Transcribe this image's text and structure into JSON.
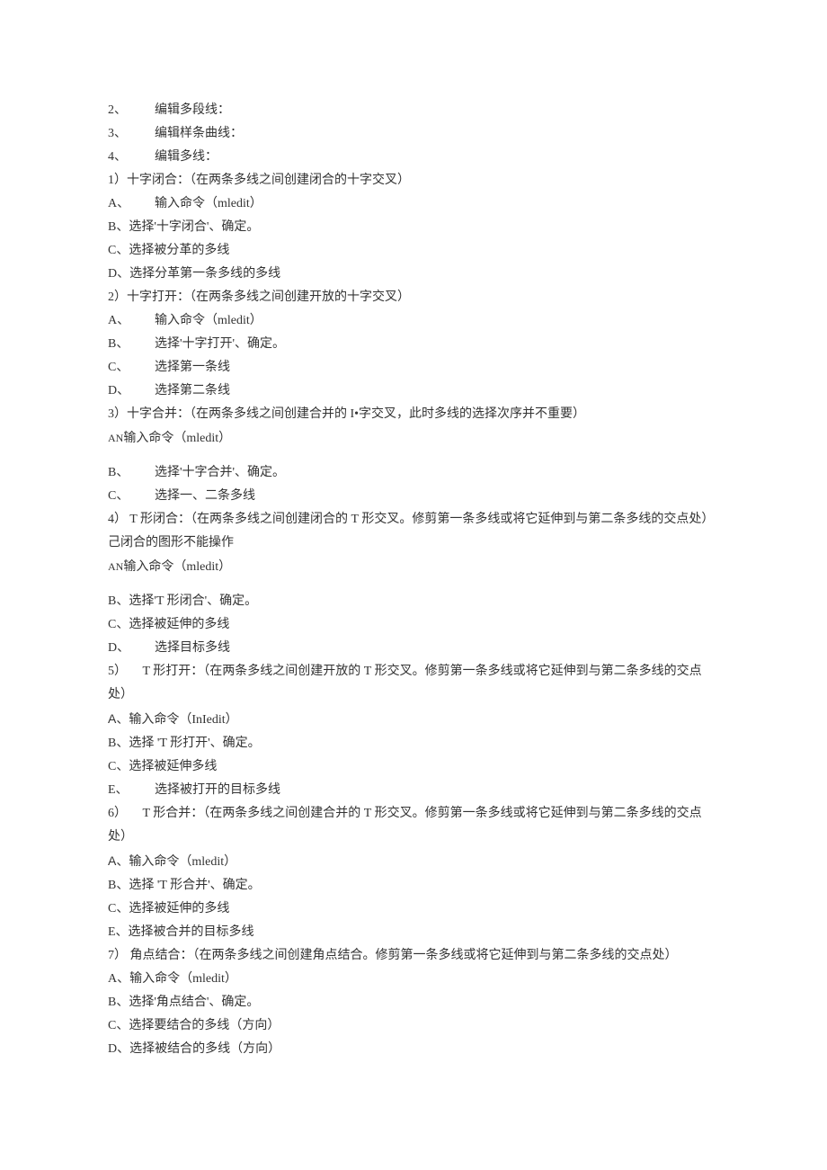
{
  "lines": {
    "l01a": "2、",
    "l01b": "编辑多段线：",
    "l02a": "3、",
    "l02b": "编辑样条曲线：",
    "l03a": "4、",
    "l03b": "编辑多线：",
    "l04": "1）十字闭合：（在两条多线之间创建闭合的十字交叉）",
    "l05a": "A、",
    "l05b": "输入命令（mledit）",
    "l06": "B、选择'十字闭合'、确定。",
    "l07": "C、选择被分革的多线",
    "l08": "D、选择分革第一条多线的多线",
    "l09": "2）十字打开：（在两条多线之间创建开放的十字交叉）",
    "l10a": "A、",
    "l10b": "输入命令（mledit）",
    "l11a": "B、",
    "l11b": "选择'十字打开'、确定。",
    "l12a": "C、",
    "l12b": "选择第一条线",
    "l13a": "D、",
    "l13b": "选择第二条线",
    "l14": "3）十字合并：（在两条多线之间创建合并的 I•字交叉，此时多线的选择次序并不重要）",
    "l15a": "A",
    "l15an": "N",
    "l15b": "输入命令（mledit）",
    "l16a": "B、",
    "l16b": "选择'十字合并'、确定。",
    "l17a": "C、",
    "l17b": "选择一、二条多线",
    "l18": "4）  T 形闭合：（在两条多线之间创建闭合的 T 形交叉。修剪第一条多线或将它延伸到与第二条多线的交点处）己闭合的图形不能操作",
    "l19a": "A",
    "l19an": "N",
    "l19b": "输入命令（mledit）",
    "l20": "B、选择'T 形闭合'、确定。",
    "l21": "C、选择被延伸的多线",
    "l22a": "D、",
    "l22b": "选择目标多线",
    "l23": "5） 　T 形打开：（在两条多线之间创建开放的 T 形交叉。修剪第一条多线或将它延伸到与第二条多线的交点处）",
    "l24a": "A",
    "l24b": "、输入命令（InIedit）",
    "l25": "B、选择 'T 形打开'、确定。",
    "l26": "C、选择被延伸多线",
    "l27a": "E、",
    "l27b": "选择被打开的目标多线",
    "l28": "6） 　T 形合并：（在两条多线之间创建合并的 T 形交叉。修剪第一条多线或将它延伸到与第二条多线的交点处）",
    "l29a": "A",
    "l29b": "、输入命令（mledit）",
    "l30": "B、选择 'T 形合并'、确定。",
    "l31": "C、选择被延伸的多线",
    "l32": "E、选择被合并的目标多线",
    "l33": "7）   角点结合：（在两条多线之间创建角点结合。修剪第一条多线或将它延伸到与第二条多线的交点处）",
    "l34": "A、输入命令（mledit）",
    "l35": "B、选择'角点结合'、确定。",
    "l36": "C、选择要结合的多线（方向）",
    "l37": "D、选择被结合的多线（方向）"
  }
}
